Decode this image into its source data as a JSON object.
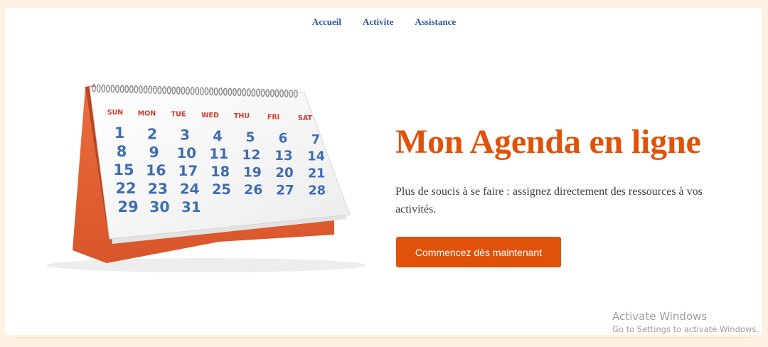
{
  "nav": {
    "items": [
      {
        "label": "Accueil"
      },
      {
        "label": "Activite"
      },
      {
        "label": "Assistance"
      }
    ]
  },
  "hero": {
    "image_alt": "calendar-image",
    "calendar": {
      "days": [
        "SUN",
        "MON",
        "TUE",
        "WED",
        "THU",
        "FRI",
        "SAT"
      ],
      "weeks": [
        [
          "1",
          "2",
          "3",
          "4",
          "5",
          "6",
          "7"
        ],
        [
          "8",
          "9",
          "10",
          "11",
          "12",
          "13",
          "14"
        ],
        [
          "15",
          "16",
          "17",
          "18",
          "19",
          "20",
          "21"
        ],
        [
          "22",
          "23",
          "24",
          "25",
          "26",
          "27",
          "28"
        ],
        [
          "29",
          "30",
          "31"
        ]
      ]
    },
    "title": "Mon Agenda en ligne",
    "subtitle": "Plus de soucis à se faire : assignez directement des ressources à vos activités.",
    "cta_label": "Commencez dès maintenant"
  },
  "watermark": {
    "title": "Activate Windows",
    "subtitle": "Go to Settings to activate Windows."
  },
  "colors": {
    "accent": "#e0520a",
    "nav_link": "#2a55a4",
    "page_bg": "#fdf1e1",
    "calendar_red": "#d23b2c",
    "calendar_blue": "#3f6db4"
  }
}
